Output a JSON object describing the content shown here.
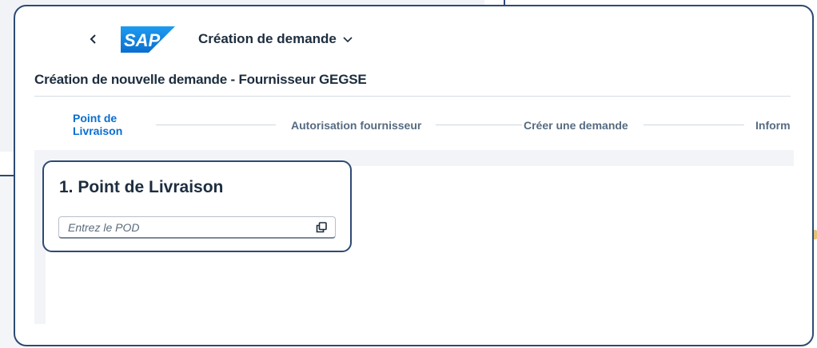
{
  "shell": {
    "app_title": "Création de demande",
    "logo_text": "SAP",
    "colors": {
      "logo_blue": "#0a6ed1",
      "frame_border": "#2d4a73"
    }
  },
  "header": {
    "page_title": "Création de nouvelle demande - Fournisseur GEGSE"
  },
  "wizard": {
    "steps": [
      {
        "line1": "Point de",
        "line2": "Livraison",
        "active": true
      },
      {
        "label": "Autorisation fournisseur"
      },
      {
        "label": "Créer une demande"
      },
      {
        "label": "Inform"
      }
    ],
    "active_color": "#0a6ed1"
  },
  "step_card": {
    "heading": "1. Point de Livraison",
    "pod_field": {
      "value": "",
      "placeholder": "Entrez le POD"
    }
  },
  "icons": {
    "back": "chevron-left-icon",
    "app_menu": "chevron-down-icon",
    "value_help": "value-help-icon"
  }
}
